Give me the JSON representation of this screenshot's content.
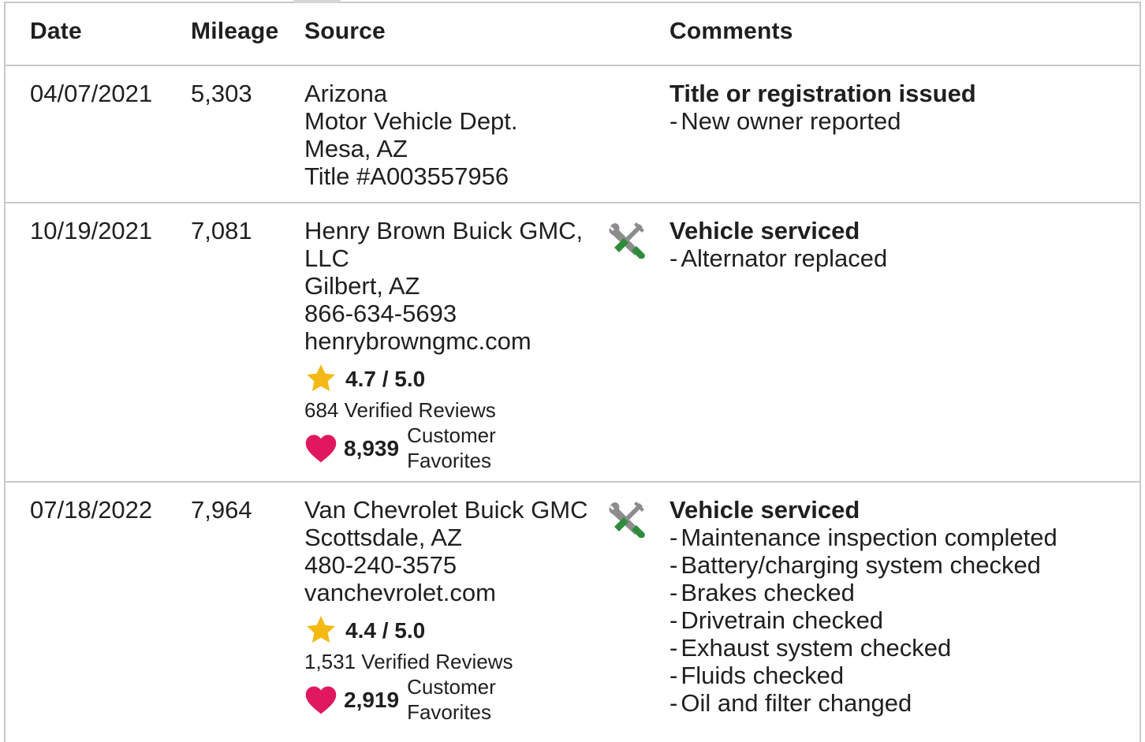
{
  "columns": {
    "date": "Date",
    "mileage": "Mileage",
    "source": "Source",
    "comments": "Comments"
  },
  "icons": {
    "service": "wrench-screwdriver-icon",
    "rating": "star-icon",
    "favorites": "heart-icon"
  },
  "colors": {
    "border": "#c9c9c9",
    "star": "#f5b915",
    "heart": "#e0195f",
    "tool_gray": "#8c8c8c",
    "tool_green": "#2e8b3a"
  },
  "records": [
    {
      "date": "04/07/2021",
      "mileage": "5,303",
      "source_lines": [
        "Arizona",
        "Motor Vehicle Dept.",
        "Mesa, AZ",
        "Title #A003557956"
      ],
      "comment_title": "Title or registration issued",
      "comment_items": [
        "New owner reported"
      ]
    },
    {
      "date": "10/19/2021",
      "mileage": "7,081",
      "source_lines": [
        "Henry Brown Buick GMC,",
        "LLC",
        "Gilbert, AZ",
        "866-634-5693",
        "henrybrowngmc.com"
      ],
      "rating": "4.7 / 5.0",
      "reviews": "684 Verified Reviews",
      "favorites_count": "8,939",
      "favorites_label_1": "Customer",
      "favorites_label_2": "Favorites",
      "comment_title": "Vehicle serviced",
      "comment_items": [
        "Alternator replaced"
      ]
    },
    {
      "date": "07/18/2022",
      "mileage": "7,964",
      "source_lines": [
        "Van Chevrolet Buick GMC",
        "Scottsdale, AZ",
        "480-240-3575",
        "vanchevrolet.com"
      ],
      "rating": "4.4 / 5.0",
      "reviews": "1,531 Verified Reviews",
      "favorites_count": "2,919",
      "favorites_label_1": "Customer",
      "favorites_label_2": "Favorites",
      "comment_title": "Vehicle serviced",
      "comment_items": [
        "Maintenance inspection completed",
        "Battery/charging system checked",
        "Brakes checked",
        "Drivetrain checked",
        "Exhaust system checked",
        "Fluids checked",
        "Oil and filter changed"
      ]
    }
  ]
}
